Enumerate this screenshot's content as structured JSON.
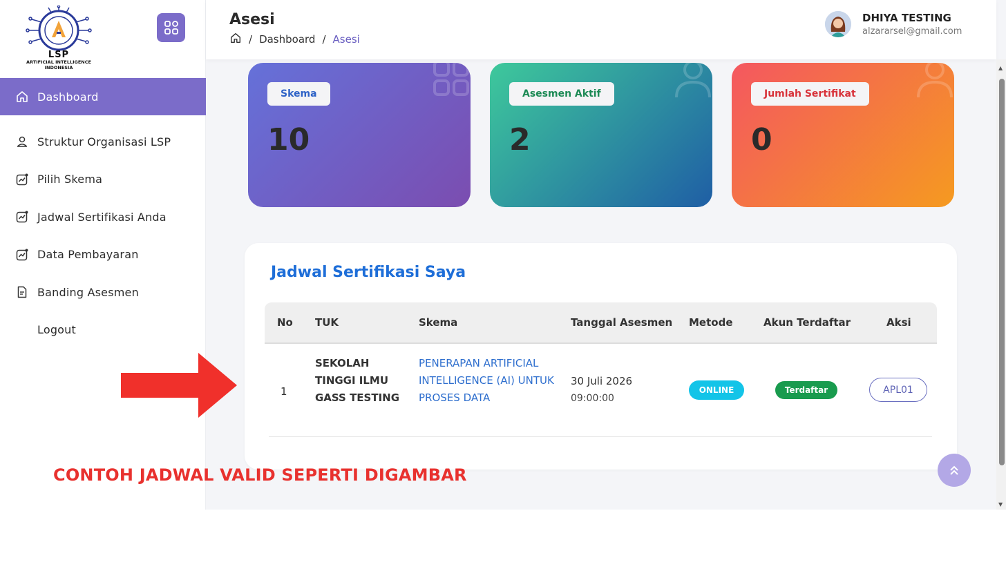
{
  "sidebar": {
    "logo_text": "LSP",
    "logo_subtext": "ARTIFICIAL INTELLIGENCE INDONESIA",
    "items": [
      {
        "label": "Dashboard",
        "icon": "home-icon",
        "active": true
      },
      {
        "label": "Struktur Organisasi LSP",
        "icon": "user-icon"
      },
      {
        "label": "Pilih Skema",
        "icon": "chart-icon"
      },
      {
        "label": "Jadwal Sertifikasi Anda",
        "icon": "chart-icon"
      },
      {
        "label": "Data Pembayaran",
        "icon": "chart-icon"
      },
      {
        "label": "Banding Asesmen",
        "icon": "document-icon"
      },
      {
        "label": "Logout",
        "icon": ""
      }
    ]
  },
  "header": {
    "title": "Asesi",
    "breadcrumb": [
      "Dashboard",
      "Asesi"
    ],
    "breadcrumb_sep": "/",
    "user_name": "DHIYA TESTING",
    "user_email": "alzararsel@gmail.com"
  },
  "cards": [
    {
      "label": "Skema",
      "value": "10",
      "colors": [
        "#6571d9",
        "#7b4db0"
      ]
    },
    {
      "label": "Asesmen Aktif",
      "value": "2",
      "colors": [
        "#3ec99b",
        "#1f5ea5"
      ]
    },
    {
      "label": "Jumlah Sertifikat",
      "value": "0",
      "colors": [
        "#f45760",
        "#f59a20"
      ]
    }
  ],
  "table": {
    "title": "Jadwal Sertifikasi Saya",
    "columns": [
      "No",
      "TUK",
      "Skema",
      "Tanggal Asesmen",
      "Metode",
      "Akun Terdaftar",
      "Aksi"
    ],
    "rows": [
      {
        "no": "1",
        "tuk": "SEKOLAH TINGGI ILMU GASS TESTING",
        "skema": "PENERAPAN ARTIFICIAL INTELLIGENCE (AI) UNTUK PROSES DATA",
        "tanggal": "30 Juli 2026",
        "waktu": "09:00:00",
        "metode": "ONLINE",
        "akun": "Terdaftar",
        "aksi": "APL01"
      }
    ]
  },
  "annotation": "CONTOH JADWAL VALID SEPERTI DIGAMBAR",
  "colors": {
    "accent": "#7b6cc9",
    "title_blue": "#1e6ed8",
    "annotation_red": "#e8312e",
    "online": "#13c4e8",
    "registered": "#199b4e"
  }
}
